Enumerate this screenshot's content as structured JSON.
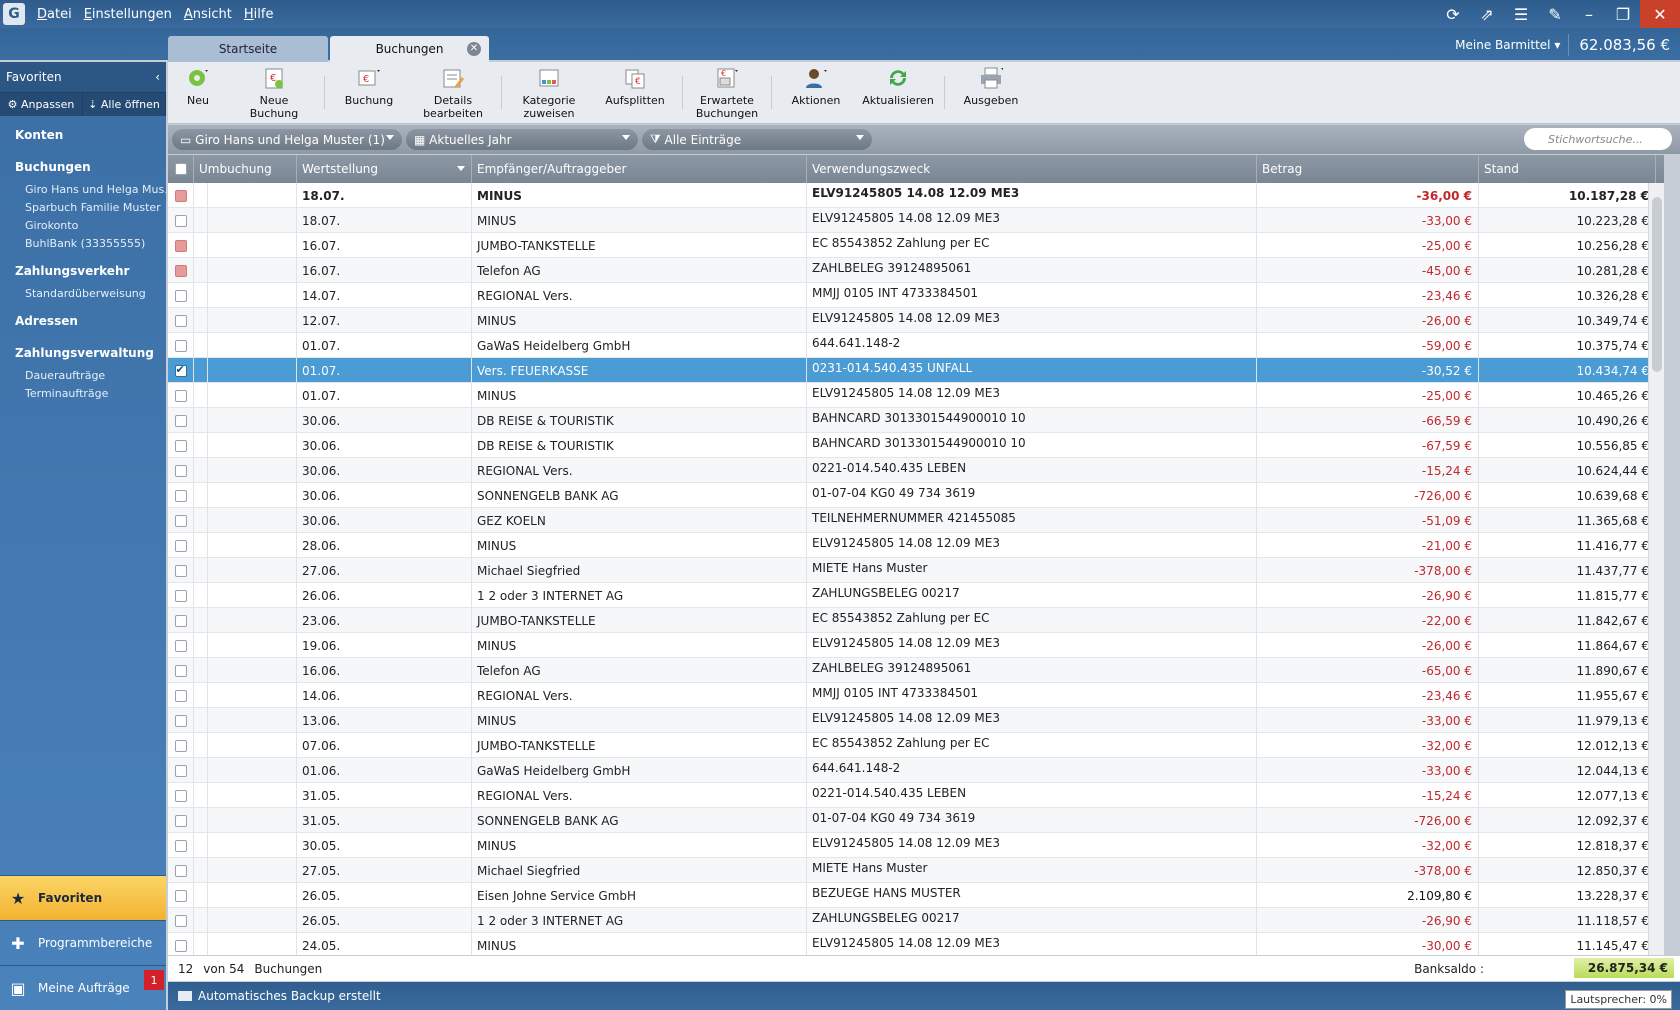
{
  "menu": [
    "Datei",
    "Einstellungen",
    "Ansicht",
    "Hilfe"
  ],
  "tabs": [
    {
      "label": "Startseite"
    },
    {
      "label": "Buchungen"
    }
  ],
  "account": {
    "name": "Meine Barmittel",
    "balance": "62.083,56 €"
  },
  "sidebar": {
    "header": "Favoriten",
    "tools": {
      "customize": "Anpassen",
      "open_all": "Alle öffnen"
    },
    "groups": [
      {
        "label": "Konten",
        "items": []
      },
      {
        "label": "Buchungen",
        "items": [
          "Giro Hans und Helga Mus...",
          "Sparbuch Familie Muster",
          "Girokonto",
          "BuhlBank (33355555)"
        ]
      },
      {
        "label": "Zahlungsverkehr",
        "items": [
          "Standardüberweisung"
        ]
      },
      {
        "label": "Adressen",
        "items": []
      },
      {
        "label": "Zahlungsverwaltung",
        "items": [
          "Daueraufträge",
          "Terminaufträge"
        ]
      }
    ],
    "bottom": {
      "favorites": "Favoriten",
      "areas": "Programmbereiche",
      "orders": "Meine Aufträge",
      "orders_badge": "1"
    }
  },
  "toolbar": {
    "neu": "Neu",
    "neue_buchung": [
      "Neue",
      "Buchung"
    ],
    "buchung": "Buchung",
    "details": [
      "Details",
      "bearbeiten"
    ],
    "kategorie": [
      "Kategorie",
      "zuweisen"
    ],
    "aufsplitten": "Aufsplitten",
    "erwartete": [
      "Erwartete",
      "Buchungen"
    ],
    "aktionen": "Aktionen",
    "aktualisieren": "Aktualisieren",
    "ausgeben": "Ausgeben"
  },
  "filters": {
    "account": "Giro Hans und Helga Muster (1)",
    "period": "Aktuelles Jahr",
    "entries": "Alle Einträge",
    "search_placeholder": "Stichwortsuche..."
  },
  "columns": [
    "Umbuchung",
    "Wertstellung",
    "Empfänger/Auftraggeber",
    "Verwendungszweck",
    "Betrag",
    "Stand"
  ],
  "rows": [
    {
      "date": "18.07.",
      "payee": "MINUS",
      "purpose": "ELV91245805 14.08 12.09 ME3",
      "amount": "-36,00 €",
      "balance": "10.187,28 €",
      "flag": true,
      "bold": true
    },
    {
      "date": "18.07.",
      "payee": "MINUS",
      "purpose": "ELV91245805 14.08 12.09 ME3",
      "amount": "-33,00 €",
      "balance": "10.223,28 €"
    },
    {
      "date": "16.07.",
      "payee": "JUMBO-TANKSTELLE",
      "purpose": "EC 85543852 Zahlung per EC",
      "amount": "-25,00 €",
      "balance": "10.256,28 €",
      "flag": true
    },
    {
      "date": "16.07.",
      "payee": "Telefon AG",
      "purpose": "ZAHLBELEG 39124895061",
      "amount": "-45,00 €",
      "balance": "10.281,28 €",
      "flag": true
    },
    {
      "date": "14.07.",
      "payee": "REGIONAL Vers.",
      "purpose": "MMJJ 0105 INT 4733384501",
      "amount": "-23,46 €",
      "balance": "10.326,28 €"
    },
    {
      "date": "12.07.",
      "payee": "MINUS",
      "purpose": "ELV91245805 14.08 12.09 ME3",
      "amount": "-26,00 €",
      "balance": "10.349,74 €"
    },
    {
      "date": "01.07.",
      "payee": "GaWaS Heidelberg GmbH",
      "purpose": "644.641.148-2",
      "amount": "-59,00 €",
      "balance": "10.375,74 €"
    },
    {
      "date": "01.07.",
      "payee": "Vers. FEUERKASSE",
      "purpose": "0231-014.540.435 UNFALL",
      "amount": "-30,52 €",
      "balance": "10.434,74 €",
      "selected": true
    },
    {
      "date": "01.07.",
      "payee": "MINUS",
      "purpose": "ELV91245805 14.08 12.09 ME3",
      "amount": "-25,00 €",
      "balance": "10.465,26 €"
    },
    {
      "date": "30.06.",
      "payee": "DB REISE & TOURISTIK",
      "purpose": "BAHNCARD 3013301544900010 10",
      "amount": "-66,59 €",
      "balance": "10.490,26 €"
    },
    {
      "date": "30.06.",
      "payee": "DB REISE & TOURISTIK",
      "purpose": "BAHNCARD 3013301544900010 10",
      "amount": "-67,59 €",
      "balance": "10.556,85 €"
    },
    {
      "date": "30.06.",
      "payee": "REGIONAL Vers.",
      "purpose": "0221-014.540.435 LEBEN",
      "amount": "-15,24 €",
      "balance": "10.624,44 €"
    },
    {
      "date": "30.06.",
      "payee": "SONNENGELB BANK AG",
      "purpose": "01-07-04 KG0 49 734 3619",
      "amount": "-726,00 €",
      "balance": "10.639,68 €"
    },
    {
      "date": "30.06.",
      "payee": "GEZ KOELN",
      "purpose": "TEILNEHMERNUMMER 421455085",
      "amount": "-51,09 €",
      "balance": "11.365,68 €"
    },
    {
      "date": "28.06.",
      "payee": "MINUS",
      "purpose": "ELV91245805 14.08 12.09 ME3",
      "amount": "-21,00 €",
      "balance": "11.416,77 €"
    },
    {
      "date": "27.06.",
      "payee": "Michael Siegfried",
      "purpose": "MIETE Hans Muster",
      "amount": "-378,00 €",
      "balance": "11.437,77 €"
    },
    {
      "date": "26.06.",
      "payee": "1 2 oder 3 INTERNET AG",
      "purpose": "ZAHLUNGSBELEG 00217",
      "amount": "-26,90 €",
      "balance": "11.815,77 €"
    },
    {
      "date": "23.06.",
      "payee": "JUMBO-TANKSTELLE",
      "purpose": "EC 85543852 Zahlung per EC",
      "amount": "-22,00 €",
      "balance": "11.842,67 €"
    },
    {
      "date": "19.06.",
      "payee": "MINUS",
      "purpose": "ELV91245805 14.08 12.09 ME3",
      "amount": "-26,00 €",
      "balance": "11.864,67 €"
    },
    {
      "date": "16.06.",
      "payee": "Telefon AG",
      "purpose": "ZAHLBELEG 39124895061",
      "amount": "-65,00 €",
      "balance": "11.890,67 €"
    },
    {
      "date": "14.06.",
      "payee": "REGIONAL Vers.",
      "purpose": "MMJJ 0105 INT 4733384501",
      "amount": "-23,46 €",
      "balance": "11.955,67 €"
    },
    {
      "date": "13.06.",
      "payee": "MINUS",
      "purpose": "ELV91245805 14.08 12.09 ME3",
      "amount": "-33,00 €",
      "balance": "11.979,13 €"
    },
    {
      "date": "07.06.",
      "payee": "JUMBO-TANKSTELLE",
      "purpose": "EC 85543852 Zahlung per EC",
      "amount": "-32,00 €",
      "balance": "12.012,13 €"
    },
    {
      "date": "01.06.",
      "payee": "GaWaS Heidelberg GmbH",
      "purpose": "644.641.148-2",
      "amount": "-33,00 €",
      "balance": "12.044,13 €"
    },
    {
      "date": "31.05.",
      "payee": "REGIONAL Vers.",
      "purpose": "0221-014.540.435 LEBEN",
      "amount": "-15,24 €",
      "balance": "12.077,13 €"
    },
    {
      "date": "31.05.",
      "payee": "SONNENGELB BANK AG",
      "purpose": "01-07-04 KG0 49 734 3619",
      "amount": "-726,00 €",
      "balance": "12.092,37 €"
    },
    {
      "date": "30.05.",
      "payee": "MINUS",
      "purpose": "ELV91245805 14.08 12.09 ME3",
      "amount": "-32,00 €",
      "balance": "12.818,37 €"
    },
    {
      "date": "27.05.",
      "payee": "Michael Siegfried",
      "purpose": "MIETE Hans Muster",
      "amount": "-378,00 €",
      "balance": "12.850,37 €"
    },
    {
      "date": "26.05.",
      "payee": "Eisen Johne Service GmbH",
      "purpose": "BEZUEGE HANS MUSTER",
      "amount": "2.109,80 €",
      "balance": "13.228,37 €",
      "positive": true
    },
    {
      "date": "26.05.",
      "payee": "1 2 oder 3 INTERNET AG",
      "purpose": "ZAHLUNGSBELEG 00217",
      "amount": "-26,90 €",
      "balance": "11.118,57 €"
    },
    {
      "date": "24.05.",
      "payee": "MINUS",
      "purpose": "ELV91245805 14.08 12.09 ME3",
      "amount": "-30,00 €",
      "balance": "11.145,47 €"
    }
  ],
  "footer": {
    "count": "12",
    "of": "von 54",
    "label": "Buchungen",
    "saldo_label": "Banksaldo :",
    "saldo": "26.875,34 €"
  },
  "status": {
    "message": "Automatisches Backup erstellt",
    "speaker": "Lautsprecher: 0%"
  }
}
